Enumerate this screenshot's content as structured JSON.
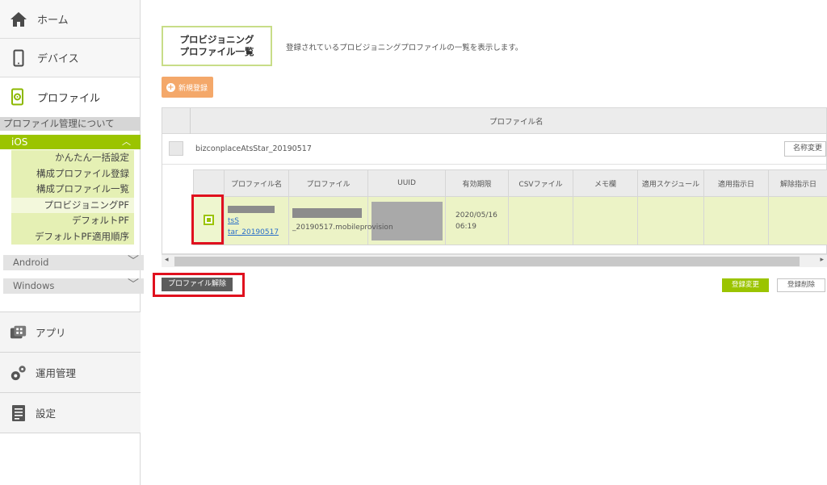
{
  "sidebar": {
    "home": "ホーム",
    "device": "デバイス",
    "profile": "プロファイル",
    "about": "プロファイル管理について",
    "ios": {
      "label": "iOS",
      "items": [
        "かんたん一括設定",
        "構成プロファイル登録",
        "構成プロファイル一覧",
        "プロビジョニングPF",
        "デフォルトPF",
        "デフォルトPF適用順序"
      ]
    },
    "android": "Android",
    "windows": "Windows",
    "app": "アプリ",
    "operation": "運用管理",
    "settings": "設定"
  },
  "page": {
    "title_line1": "プロビジョニング",
    "title_line2": "プロファイル一覧",
    "description": "登録されているプロビジョニングプロファイルの一覧を表示します。",
    "new_button": "新規登録"
  },
  "table": {
    "header": "プロファイル名",
    "row_name": "bizconplaceAtsStar_20190517",
    "rename_button": "名称変更",
    "columns": [
      "プロファイル名",
      "プロファイル",
      "UUID",
      "有効期限",
      "CSVファイル",
      "メモ欄",
      "適用スケジュール",
      "適用指示日",
      "解除指示日"
    ],
    "row": {
      "name_part1": "tsS",
      "name_part2": "tar_20190517",
      "file_part": "_20190517.mobileprovision",
      "expiry_date": "2020/05/16",
      "expiry_time": "06:19"
    }
  },
  "actions": {
    "release": "プロファイル解除",
    "register_change": "登録変更",
    "register_delete": "登録削除"
  },
  "colors": {
    "accent": "#9bc400",
    "highlight": "#e0101e",
    "new_button": "#f4a86a"
  }
}
